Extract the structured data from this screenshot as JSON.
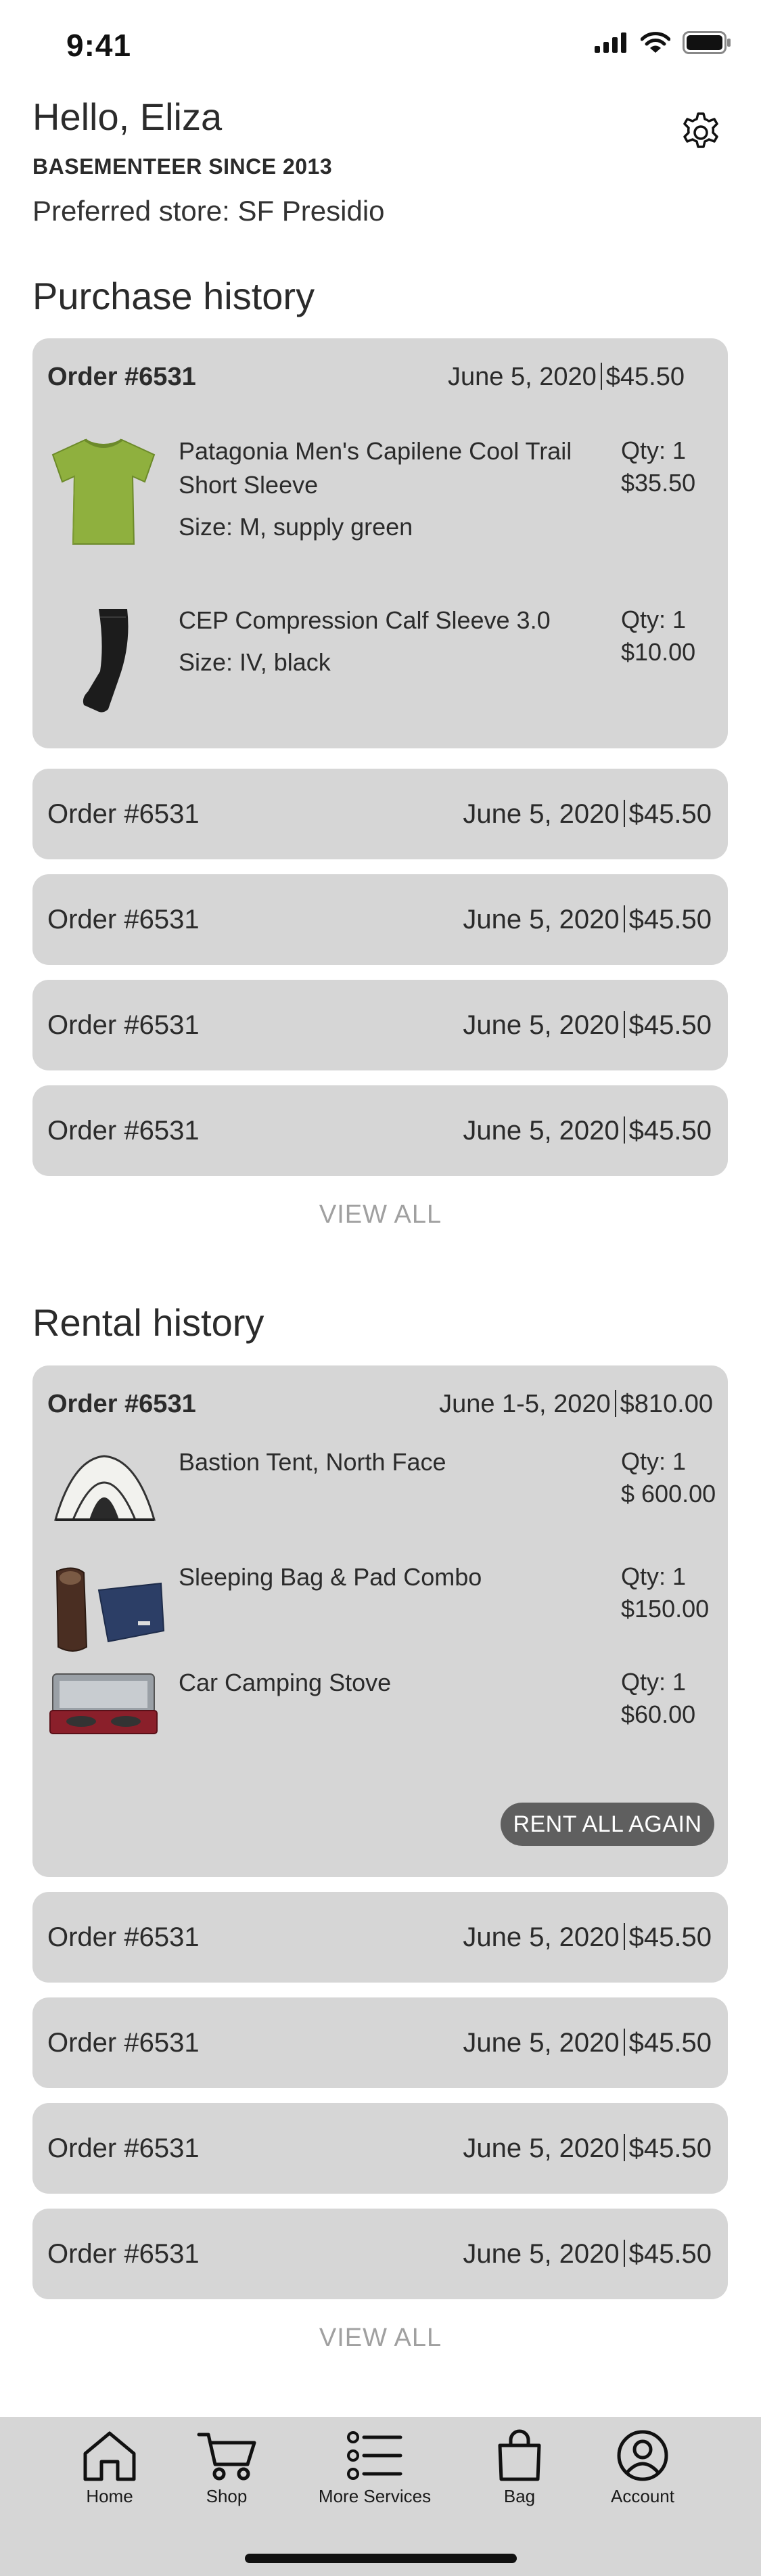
{
  "status_bar": {
    "time": "9:41"
  },
  "profile": {
    "greeting": "Hello, Eliza",
    "member_since": "BASEMENTEER SINCE 2013",
    "preferred_store": "Preferred store: SF Presidio"
  },
  "purchase_history": {
    "title": "Purchase history",
    "expanded_order": {
      "order_no": "Order #6531",
      "date": "June 5, 2020",
      "total": "$45.50",
      "items": [
        {
          "name": "Patagonia Men's Capilene Cool Trail Short Sleeve",
          "meta": "Size: M, supply green",
          "qty": "Qty: 1",
          "price": "$35.50",
          "image": "green-tshirt"
        },
        {
          "name": "CEP Compression Calf Sleeve 3.0",
          "meta": "Size: IV, black",
          "qty": "Qty: 1",
          "price": "$10.00",
          "image": "black-calf-sleeve"
        }
      ]
    },
    "orders": [
      {
        "order_no": "Order #6531",
        "date": "June 5, 2020",
        "total": "$45.50"
      },
      {
        "order_no": "Order #6531",
        "date": "June 5, 2020",
        "total": "$45.50"
      },
      {
        "order_no": "Order #6531",
        "date": "June 5, 2020",
        "total": "$45.50"
      },
      {
        "order_no": "Order #6531",
        "date": "June 5, 2020",
        "total": "$45.50"
      }
    ],
    "view_all": "VIEW ALL"
  },
  "rental_history": {
    "title": "Rental history",
    "expanded_order": {
      "order_no": "Order #6531",
      "date": "June 1-5, 2020",
      "total": "$810.00",
      "items": [
        {
          "name": "Bastion Tent, North Face",
          "qty": "Qty: 1",
          "price": "$ 600.00",
          "image": "tent"
        },
        {
          "name": "Sleeping Bag & Pad Combo",
          "qty": "Qty: 1",
          "price": "$150.00",
          "image": "sleeping-bag"
        },
        {
          "name": "Car Camping Stove",
          "qty": "Qty: 1",
          "price": "$60.00",
          "image": "camping-stove"
        }
      ],
      "rent_again_label": "RENT ALL AGAIN"
    },
    "orders": [
      {
        "order_no": "Order #6531",
        "date": "June 5, 2020",
        "total": "$45.50"
      },
      {
        "order_no": "Order #6531",
        "date": "June 5, 2020",
        "total": "$45.50"
      },
      {
        "order_no": "Order #6531",
        "date": "June 5, 2020",
        "total": "$45.50"
      },
      {
        "order_no": "Order #6531",
        "date": "June 5, 2020",
        "total": "$45.50"
      }
    ],
    "view_all": "VIEW ALL"
  },
  "tab_bar": {
    "items": [
      {
        "label": "Home",
        "icon": "home-icon"
      },
      {
        "label": "Shop",
        "icon": "cart-icon"
      },
      {
        "label": "More Services",
        "icon": "list-icon"
      },
      {
        "label": "Bag",
        "icon": "bag-icon"
      },
      {
        "label": "Account",
        "icon": "account-icon"
      }
    ]
  },
  "colors": {
    "card_background": "#d6d6d6",
    "button_background": "#5f5f5f",
    "muted_text": "#a0a0a0"
  }
}
